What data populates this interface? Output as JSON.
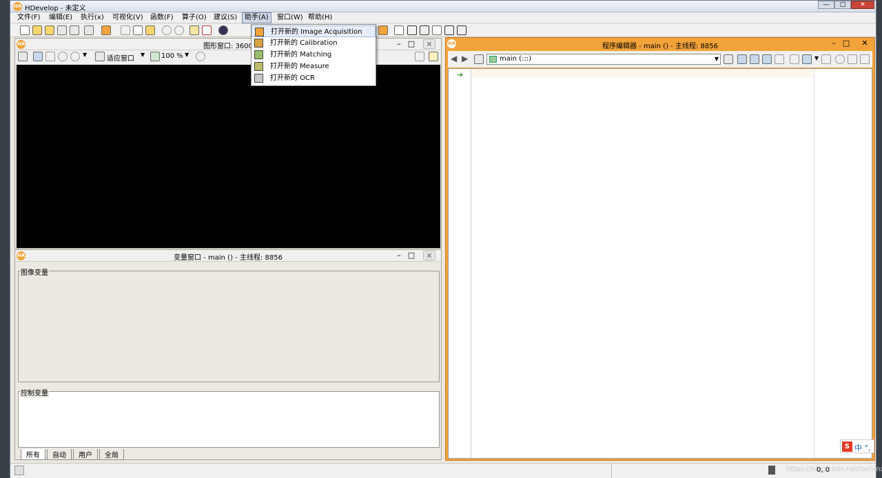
{
  "window": {
    "title": "HDevelop - 未定义",
    "minimize": "—",
    "maximize": "□",
    "close": "✕"
  },
  "menus": [
    "文件(F)",
    "编辑(E)",
    "执行(x)",
    "可视化(V)",
    "函数(F)",
    "算子(O)",
    "建议(S)",
    "助手(A)",
    "窗口(W)",
    "帮助(H)"
  ],
  "assistant_menu": {
    "items": [
      {
        "label": "打开新的 Image Acquisition",
        "icon": "image-acquisition-icon"
      },
      {
        "label": "打开新的 Calibration",
        "icon": "calibration-icon"
      },
      {
        "label": "打开新的 Matching",
        "icon": "matching-icon"
      },
      {
        "label": "打开新的 Measure",
        "icon": "measure-icon"
      },
      {
        "label": "打开新的 OCR",
        "icon": "ocr-icon"
      }
    ]
  },
  "graphics_window": {
    "title": "图形窗口: 3600",
    "fit_label": "适应窗口",
    "zoom": "100 %"
  },
  "variable_window": {
    "title": "变量窗口 - main () - 主线程: 8856",
    "iconic_label": "图像变量",
    "control_label": "控制变量",
    "tabs": [
      "所有",
      "自动",
      "用户",
      "全局"
    ]
  },
  "program_editor": {
    "title": "程序编辑器 - main () - 主线程: 8856",
    "procedure": "main (:::)"
  },
  "status": {
    "coords": "0, 0",
    "watermark": "https://blog.csdn.net/lashinx"
  },
  "ime": {
    "label": "中 °,"
  },
  "colors": {
    "accent": "#f2a33a",
    "canvas": "#000000",
    "editor_bg": "#ffffff"
  }
}
